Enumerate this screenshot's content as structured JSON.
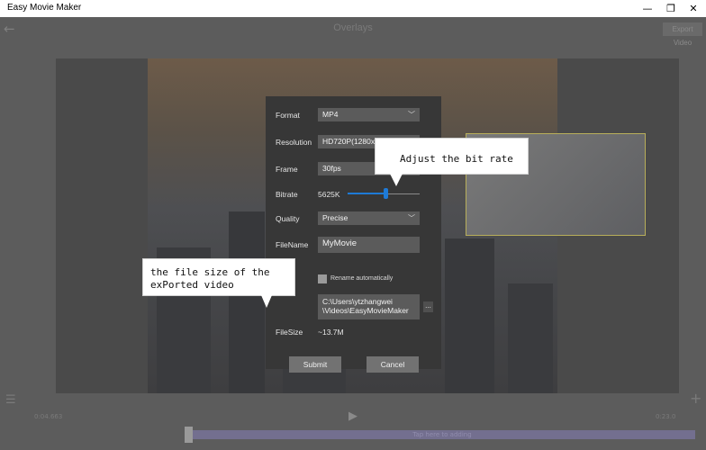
{
  "window": {
    "title": "Easy Movie Maker",
    "minimize": "—",
    "maximize": "❐",
    "close": "✕"
  },
  "header": {
    "back_icon": "←",
    "title": "Overlays",
    "export_label": "Export Video"
  },
  "dialog": {
    "format": {
      "label": "Format",
      "value": "MP4"
    },
    "resolution": {
      "label": "Resolution",
      "value": "HD720P(1280x720)"
    },
    "frame": {
      "label": "Frame",
      "value": "30fps"
    },
    "bitrate": {
      "label": "Bitrate",
      "value": "5625K",
      "level": 0.52
    },
    "quality": {
      "label": "Quality",
      "value": "Precise"
    },
    "filename": {
      "label": "FileName",
      "value": "MyMovie"
    },
    "rename": {
      "label": "Rename automatically",
      "checked": false
    },
    "path": {
      "line1": "C:\\Users\\ytzhangwei",
      "line2": "\\Videos\\EasyMovieMaker",
      "browse_label": "..."
    },
    "filesize": {
      "label": "FileSize",
      "value": "~13.7M"
    },
    "submit_label": "Submit",
    "cancel_label": "Cancel"
  },
  "callouts": {
    "bitrate": "Adjust the bit rate",
    "filesize_line1": "the file size of the",
    "filesize_line2": "exPorted video"
  },
  "playback": {
    "current_time": "0:04.663",
    "total_time": "0:23.0",
    "timeline_text": "Tap here to adding"
  },
  "colors": {
    "accent": "#1e7ad6",
    "dialog_bg": "#373737",
    "overlay_border": "#b8ae5a"
  }
}
